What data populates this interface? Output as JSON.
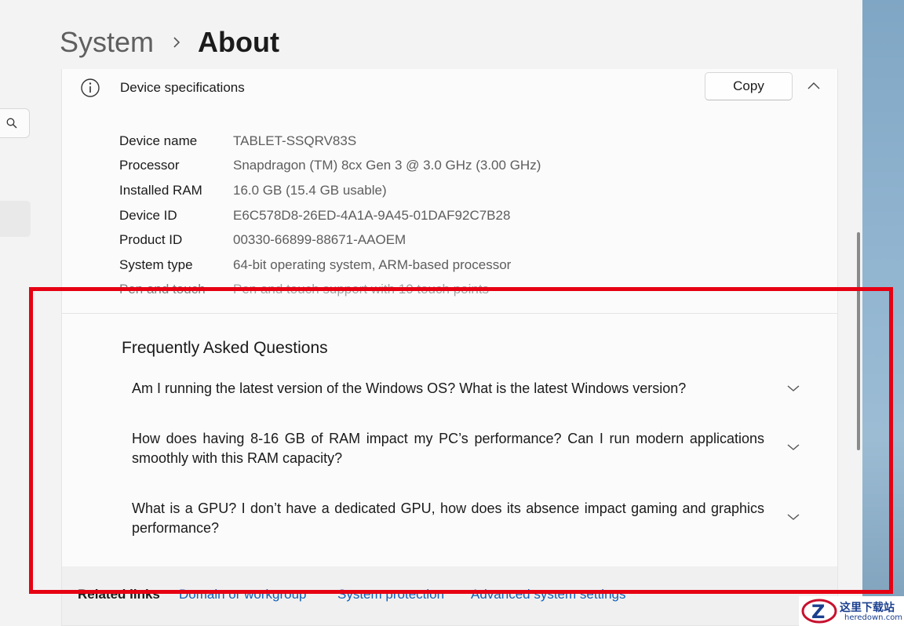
{
  "breadcrumb": {
    "parent": "System",
    "current": "About"
  },
  "device_specs": {
    "title": "Device specifications",
    "copy_label": "Copy",
    "rows": [
      {
        "label": "Device name",
        "value": "TABLET-SSQRV83S"
      },
      {
        "label": "Processor",
        "value": "Snapdragon (TM) 8cx Gen 3 @ 3.0 GHz (3.00 GHz)"
      },
      {
        "label": "Installed RAM",
        "value": "16.0 GB (15.4 GB usable)"
      },
      {
        "label": "Device ID",
        "value": "E6C578D8-26ED-4A1A-9A45-01DAF92C7B28"
      },
      {
        "label": "Product ID",
        "value": "00330-66899-88671-AAOEM"
      },
      {
        "label": "System type",
        "value": "64-bit operating system, ARM-based processor"
      },
      {
        "label": "Pen and touch",
        "value": "Pen and touch support with 10 touch points"
      }
    ]
  },
  "faq": {
    "title": "Frequently Asked Questions",
    "items": [
      {
        "question": "Am I running the latest version of the Windows OS? What is the latest Windows version?"
      },
      {
        "question": "How does having 8-16 GB of RAM impact my PC’s performance? Can I run modern applications smoothly with this RAM capacity?"
      },
      {
        "question": "What is a GPU? I don’t have a dedicated GPU, how does its absence impact gaming and graphics performance?"
      }
    ]
  },
  "related": {
    "label": "Related links",
    "links": [
      "Domain or workgroup",
      "System protection",
      "Advanced system settings"
    ]
  },
  "watermark": {
    "cn": "这里下载站",
    "en": "heredown.com"
  },
  "colors": {
    "accent_link": "#0f5fb5",
    "highlight_border": "#e60012"
  }
}
